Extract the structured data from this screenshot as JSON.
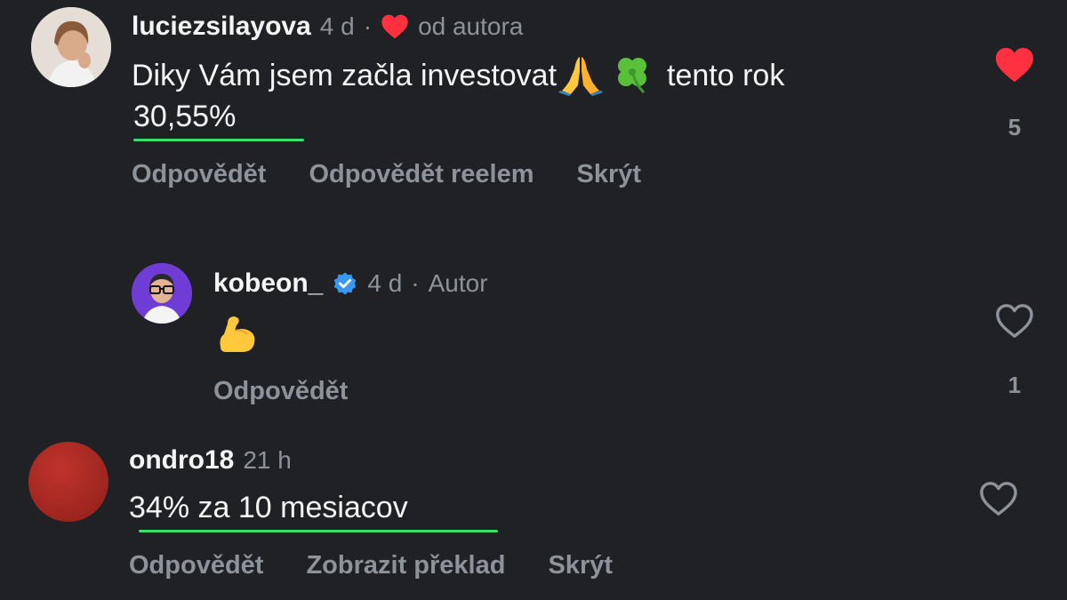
{
  "comments": [
    {
      "username": "luciezsilayova",
      "time": "4 d",
      "separator": "·",
      "liked_by_author_label": "od autora",
      "text_before": "Diky Vám jsem začla investovat",
      "text_after": "tento rok",
      "highlight": "30,55%",
      "like_count": "5",
      "actions": [
        "Odpovědět",
        "Odpovědět reelem",
        "Skrýt"
      ]
    },
    {
      "username": "kobeon_",
      "time": "4 d",
      "separator": "·",
      "role": "Autor",
      "like_count": "1",
      "actions": [
        "Odpovědět"
      ]
    },
    {
      "username": "ondro18",
      "time": "21 h",
      "text": "34% za 10 mesiacov",
      "actions": [
        "Odpovědět",
        "Zobrazit překlad",
        "Skrýt"
      ]
    }
  ],
  "icons": {
    "liked_heart": "heart-filled-icon",
    "empty_heart": "heart-outline-icon",
    "verified": "verified-badge-icon",
    "pray": "pray-emoji-icon",
    "clover": "clover-emoji-icon",
    "muscle": "flexed-biceps-emoji-icon"
  },
  "colors": {
    "background": "#1f2125",
    "text": "#f5f5f5",
    "muted": "#8e9299",
    "like_red": "#ff3040",
    "highlight_underline": "#3fdc6e",
    "verified_blue": "#3897f0"
  }
}
